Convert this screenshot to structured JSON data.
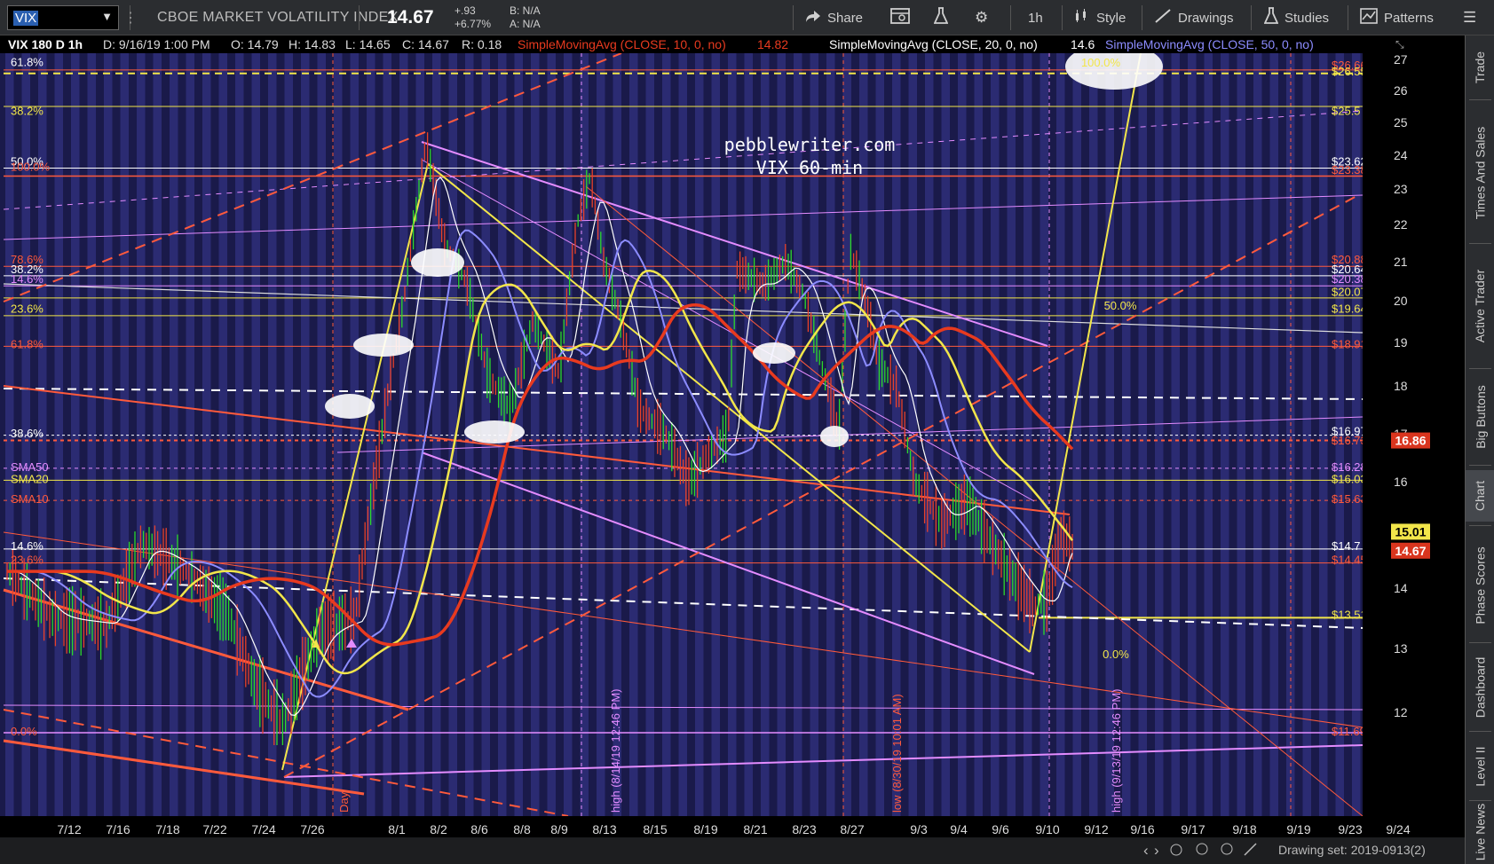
{
  "toolbar": {
    "symbol": "VIX",
    "description": "CBOE MARKET VOLATILITY INDEX",
    "last": "14.67",
    "change": "+.93",
    "change_pct": "+6.77%",
    "bid": "B: N/A",
    "ask": "A: N/A",
    "share": "Share",
    "timeframe": "1h",
    "style": "Style",
    "drawings": "Drawings",
    "studies": "Studies",
    "patterns": "Patterns"
  },
  "header": {
    "symbol_label": "VIX 180 D 1h",
    "date": "D: 9/16/19 1:00 PM",
    "open": "O: 14.79",
    "high": "H: 14.83",
    "low": "L: 14.65",
    "close": "C: 14.67",
    "range": "R: 0.18",
    "sma10_label": "SimpleMovingAvg (CLOSE, 10, 0, no)",
    "sma10_value": "14.82",
    "sma20_label": "SimpleMovingAvg (CLOSE, 20, 0, no)",
    "sma20_value": "14.6",
    "sma50_label": "SimpleMovingAvg (CLOSE, 50, 0, no)"
  },
  "watermark": {
    "line1": "pebblewriter.com",
    "line2": "VIX 60-min"
  },
  "price_axis": {
    "ticks": [
      27,
      26,
      25,
      24,
      23,
      22,
      21,
      20,
      19,
      18,
      17,
      16,
      15,
      14,
      13,
      12
    ],
    "badge_sma": "16.86",
    "badge_sma_color": "#d9351e",
    "badge_yellow": "15.01",
    "badge_last": "14.67",
    "badge_last_color": "#d9351e"
  },
  "time_axis": {
    "labels": [
      "7/12",
      "7/16",
      "7/18",
      "7/22",
      "7/24",
      "7/26",
      "8/1",
      "8/2",
      "8/6",
      "8/8",
      "8/9",
      "8/13",
      "8/15",
      "8/19",
      "8/21",
      "8/23",
      "8/27",
      "9/3",
      "9/4",
      "9/6",
      "9/10",
      "9/12",
      "9/16",
      "9/17",
      "9/18",
      "9/19",
      "9/23",
      "9/24"
    ]
  },
  "status": {
    "drawing_set": "Drawing set: 2019-0913(2)"
  },
  "left_labels": [
    {
      "text": "61.8%",
      "color": "#ffffff",
      "price": 26.9
    },
    {
      "text": "38.2%",
      "color": "#f2e64a",
      "price": 25.35
    },
    {
      "text": "50.0%",
      "color": "#ffffff",
      "price": 23.8
    },
    {
      "text": "100.0%",
      "color": "#ff5a3c",
      "price": 23.65
    },
    {
      "text": "78.6%",
      "color": "#ff5a3c",
      "price": 21.05
    },
    {
      "text": "38.2%",
      "color": "#ffffff",
      "price": 20.8
    },
    {
      "text": "14.6%",
      "color": "#e48cff",
      "price": 20.55
    },
    {
      "text": "23.6%",
      "color": "#f2e64a",
      "price": 19.8
    },
    {
      "text": "61.8%",
      "color": "#ff5a3c",
      "price": 18.95
    },
    {
      "text": "38.6%",
      "color": "#ffffff",
      "price": 17.0
    },
    {
      "text": "SMA50",
      "color": "#e48cff",
      "price": 16.3
    },
    {
      "text": "SMA20",
      "color": "#f2e64a",
      "price": 16.05
    },
    {
      "text": "SMA10",
      "color": "#ff5a3c",
      "price": 15.65
    },
    {
      "text": "14.6%",
      "color": "#ffffff",
      "price": 14.75
    },
    {
      "text": "23.6%",
      "color": "#ff5a3c",
      "price": 14.5
    },
    {
      "text": "0.0%",
      "color": "#ff5a3c",
      "price": 11.7
    }
  ],
  "right_labels": [
    {
      "text": "$26.66",
      "color": "#ff5a3c",
      "price": 26.8
    },
    {
      "text": "$26.55",
      "color": "#f2e64a",
      "price": 26.6
    },
    {
      "text": "$25.5",
      "color": "#f2e64a",
      "price": 25.35
    },
    {
      "text": "$23.62",
      "color": "#ffffff",
      "price": 23.8
    },
    {
      "text": "$23.38",
      "color": "#ff5a3c",
      "price": 23.55
    },
    {
      "text": "$20.88",
      "color": "#ff5a3c",
      "price": 21.05
    },
    {
      "text": "$20.64",
      "color": "#ffffff",
      "price": 20.8
    },
    {
      "text": "$20.38",
      "color": "#e48cff",
      "price": 20.55
    },
    {
      "text": "$20.07",
      "color": "#f2e64a",
      "price": 20.22
    },
    {
      "text": "$19.64",
      "color": "#f2e64a",
      "price": 19.8
    },
    {
      "text": "$18.91",
      "color": "#ff5a3c",
      "price": 18.95
    },
    {
      "text": "$16.97",
      "color": "#ffffff",
      "price": 17.05
    },
    {
      "text": "$16.73",
      "color": "#ff5a3c",
      "price": 16.85
    },
    {
      "text": "$16.28",
      "color": "#e48cff",
      "price": 16.3
    },
    {
      "text": "$16.03",
      "color": "#f2e64a",
      "price": 16.05
    },
    {
      "text": "$15.63",
      "color": "#ff5a3c",
      "price": 15.65
    },
    {
      "text": "$14.7",
      "color": "#ffffff",
      "price": 14.75
    },
    {
      "text": "$14.45",
      "color": "#ff5a3c",
      "price": 14.5
    },
    {
      "text": "$13.51",
      "color": "#f2e64a",
      "price": 13.55
    },
    {
      "text": "$11.69",
      "color": "#ff5a3c",
      "price": 11.7
    }
  ],
  "chart_labels": {
    "fib_100": "100.0%",
    "fib_50": "50.0%",
    "fib_0": "0.0%",
    "day": "Day",
    "high_1": "high (8/14/19 12:46 PM)",
    "low_1": "low (8/30/19 10:01 AM)",
    "high_2": "high (9/13/19 12:46 PM)",
    "low_2": "low (9/24/19 10:05 AM)"
  },
  "sidebar": {
    "tabs": [
      "Trade",
      "Times And Sales",
      "Active Trader",
      "Big Buttons",
      "Chart",
      "Phase Scores",
      "Dashboard",
      "Level II",
      "Live News"
    ]
  }
}
